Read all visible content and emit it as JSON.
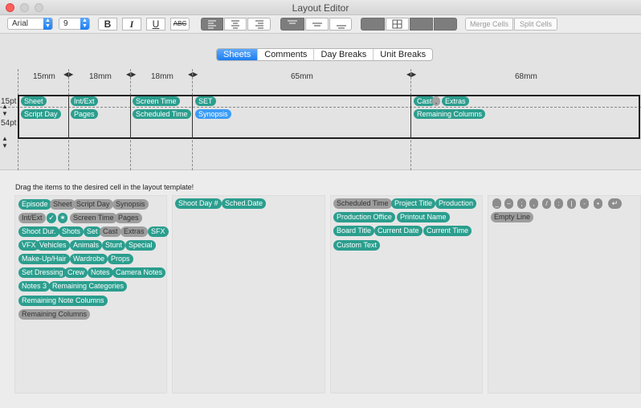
{
  "window": {
    "title": "Layout Editor"
  },
  "toolbar": {
    "font_name": "Arial",
    "font_size": "9",
    "bold": "B",
    "italic": "I",
    "underline": "U",
    "strike": "ABC",
    "merge_cells": "Merge Cells",
    "split_cells": "Split Cells"
  },
  "tabs": [
    "Sheets",
    "Comments",
    "Day Breaks",
    "Unit Breaks"
  ],
  "template": {
    "column_widths": [
      "15mm",
      "18mm",
      "18mm",
      "65mm",
      "68mm"
    ],
    "row_heights": [
      "15pt",
      "54pt"
    ],
    "cells": {
      "c1": [
        "Sheet",
        "Script Day"
      ],
      "c2": [
        "Int/Ext",
        "Pages"
      ],
      "c3": [
        "Screen Time",
        "Scheduled Time"
      ],
      "c4": [
        "SET",
        "Synopsis"
      ],
      "c5a": [
        "Cast",
        ",",
        "Extras"
      ],
      "c5b": [
        "Remaining Columns"
      ]
    }
  },
  "hint": "Drag the items to the desired cell in the layout template!",
  "palette": {
    "p1": [
      [
        "Episode",
        "Sheet",
        "Script Day",
        "Synopsis"
      ],
      [
        "Int/Ext",
        "✓",
        "✶",
        "Screen Time",
        "Pages"
      ],
      [
        "Shoot Dur.",
        "Shots",
        "Set",
        "Cast",
        "Extras",
        "SFX"
      ],
      [
        "VFX",
        "Vehicles",
        "Animals",
        "Stunt",
        "Special"
      ],
      [
        "Make-Up/Hair",
        "Wardrobe",
        "Props"
      ],
      [
        "Set Dressing",
        "Crew",
        "Notes",
        "Camera Notes"
      ],
      [
        "Notes 3",
        "Remaining Categories"
      ],
      [
        "Remaining Note Columns"
      ],
      [
        "Remaining Columns"
      ]
    ],
    "p2": [
      [
        "Shoot Day #",
        "Sched.Date"
      ]
    ],
    "p3": [
      [
        "Scheduled Time",
        "Project Title",
        "Production"
      ],
      [
        "Production Office",
        "Printout Name"
      ],
      [
        "Board Title",
        "Current Date",
        "Current Time"
      ],
      [
        "Custom Text"
      ]
    ],
    "p4_symbols": [
      "_",
      "–",
      ";",
      ",",
      "/",
      ":",
      "|",
      "-",
      "•",
      "↵"
    ],
    "p4_empty": "Empty Line"
  }
}
